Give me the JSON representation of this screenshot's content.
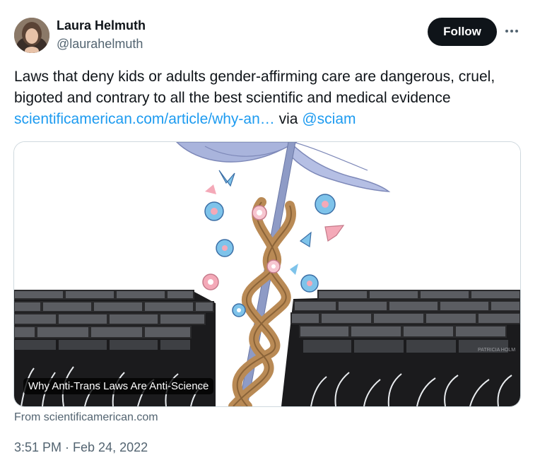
{
  "author": {
    "name": "Laura Helmuth",
    "handle": "@laurahelmuth"
  },
  "actions": {
    "follow_label": "Follow",
    "more_icon": "more-horizontal-icon"
  },
  "tweet": {
    "text": "Laws that deny kids or adults gender-affirming care are dangerous, cruel, bigoted and contrary to all the best scientific and medical evidence",
    "link_text": "scientificamerican.com/article/why-an…",
    "via_text": "via",
    "mention": "@sciam"
  },
  "card": {
    "title": "Why Anti-Trans Laws Are Anti-Science",
    "source": "From scientificamerican.com",
    "artist_signature": "PATRICIA HOLM"
  },
  "timestamp": "3:51 PM · Feb 24, 2022",
  "colors": {
    "text": "#0f1419",
    "secondary": "#536471",
    "link": "#1d9bf0",
    "follow_bg": "#0f1419"
  }
}
